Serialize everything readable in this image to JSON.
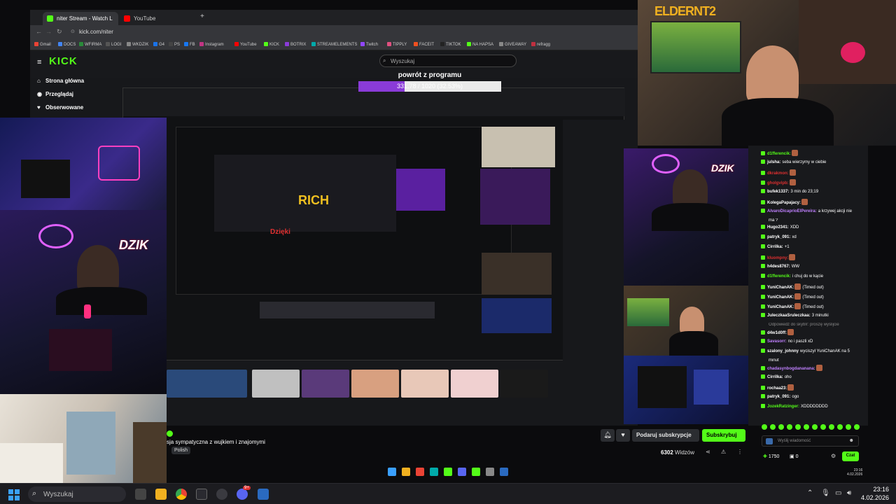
{
  "browser": {
    "tabs": [
      {
        "label": "niter Stream - Watch Live on K",
        "active": true,
        "color": "#53fc18"
      },
      {
        "label": "YouTube",
        "active": false,
        "color": "#ff0000"
      }
    ],
    "new_tab": "+",
    "url": "kick.com/niter",
    "bookmarks": [
      "Gmail",
      "DOCS",
      "WFIRMA",
      "LOGI",
      "WKDZIK",
      "G4",
      "PS",
      "FB",
      "Instagram",
      "YouTube",
      "KICK",
      "BOTRIX",
      "STREAMELEMENTS",
      "Twitch",
      "TIPPLY",
      "FACEIT",
      "TIKTOK",
      "NA HAPSA",
      "GIVEAWAY",
      "refragg"
    ]
  },
  "kick": {
    "logo": "KICK",
    "search_placeholder": "Wyszukaj",
    "sidebar": [
      {
        "label": "Strona główna",
        "icon": "home-icon"
      },
      {
        "label": "Przeglądaj",
        "icon": "browse-icon"
      },
      {
        "label": "Obserwowane",
        "icon": "heart-icon"
      }
    ]
  },
  "overlay": {
    "title": "powrót z programu",
    "progress_text": "331.78 / 1020 (32.53%)",
    "progress_fraction": 0.3253
  },
  "streamer_logo": "ELDERNT2",
  "cam_badges": [
    "DZIK",
    "DZIK"
  ],
  "stream_info": {
    "title": "sja sympatyczna z wujkiem i znajomymi",
    "language": "Polish",
    "viewers": "6302",
    "viewers_label": "Widzów",
    "gift_subs": "Podaruj subskrypcje",
    "subscribe": "Subskrybuj"
  },
  "chat": {
    "messages": [
      {
        "user": "d1fferencik:",
        "text": "",
        "color": "#53fc18",
        "emote": true
      },
      {
        "user": "julsha:",
        "text": "seba wierzymy w ciebie",
        "color": "#ffffff"
      },
      {
        "user": "dkrakmon:",
        "text": "",
        "color": "#e03030",
        "emote": true
      },
      {
        "user": "gholgvipb:",
        "text": "",
        "color": "#e03030",
        "emote": true
      },
      {
        "user": "bufek1337:",
        "text": "3 min do 23;19",
        "color": "#ffffff"
      },
      {
        "user": "KolegaPapajacy:",
        "text": "",
        "color": "#ffffff",
        "emote": true
      },
      {
        "user": "AlvaroDicaprioElPereira:",
        "text": "a krzywej akcji nie",
        "color": "#c080ff"
      },
      {
        "user": "",
        "text": "ma ?",
        "color": "#ffffff"
      },
      {
        "user": "Hugo2341:",
        "text": "XDD",
        "color": "#ffffff"
      },
      {
        "user": "patryk_091:",
        "text": "xd",
        "color": "#ffffff"
      },
      {
        "user": "Cirrilka:",
        "text": "+1",
        "color": "#ffffff"
      },
      {
        "user": "kluompny:",
        "text": "",
        "color": "#e03030",
        "emote": true
      },
      {
        "user": "h4des8767:",
        "text": "WW",
        "color": "#ffffff"
      },
      {
        "user": "d1fferencik:",
        "text": "i chuj do w kącie",
        "color": "#53fc18"
      },
      {
        "user": "YuniChanAK:",
        "text": "(Timed out)",
        "color": "#ffffff",
        "emote": true
      },
      {
        "user": "YuniChanAK:",
        "text": "(Timed out)",
        "color": "#ffffff",
        "emote": true
      },
      {
        "user": "YuniChanAK:",
        "text": "(Timed out)",
        "color": "#ffffff",
        "emote": true
      },
      {
        "user": "JuleczkaaSruleczkaa:",
        "text": "3 minutki",
        "color": "#ffffff"
      },
      {
        "user": "",
        "text": "Odpowiedź do skyblr: proszę wyślijcie",
        "color": "#888888"
      },
      {
        "user": "d4w1d0ff:",
        "text": "",
        "color": "#ffffff",
        "emote": true
      },
      {
        "user": "Savasorr:",
        "text": "no i paszli xD",
        "color": "#c080ff"
      },
      {
        "user": "szalony_johnny",
        "text": "wyciszył YuniChanAK na 5",
        "color": "#ffffff"
      },
      {
        "user": "",
        "text": "minut",
        "color": "#ffffff"
      },
      {
        "user": "chadasynbogdananana:",
        "text": "",
        "color": "#c080ff",
        "emote": true
      },
      {
        "user": "Cirrilka:",
        "text": "oho",
        "color": "#ffffff"
      },
      {
        "user": "rochaa23:",
        "text": "",
        "color": "#ffffff",
        "emote": true
      },
      {
        "user": "patryk_091:",
        "text": "ogo",
        "color": "#ffffff"
      },
      {
        "user": "JozekRatzinger:",
        "text": "XDDDDDDDD",
        "color": "#53fc18"
      }
    ],
    "input_placeholder": "Wyślij wiadomość",
    "points": "1750",
    "count": "0",
    "send": "Czat"
  },
  "taskbar": {
    "search": "Wyszukaj",
    "time": "23:16",
    "date": "4.02.2026",
    "notif_badge": "9+"
  },
  "colors": {
    "kick_green": "#53fc18",
    "progress_purple": "#8a3bd8"
  }
}
